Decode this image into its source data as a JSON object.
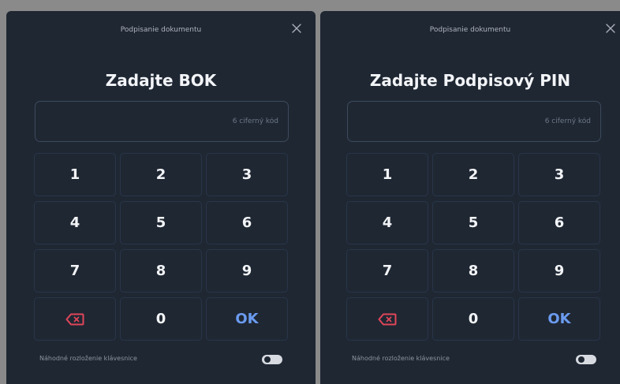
{
  "dialogs": [
    {
      "header_title": "Podpisanie dokumentu",
      "heading": "Zadajte BOK",
      "input_placeholder": "6 ciferný kód",
      "input_value": "",
      "keys": [
        "1",
        "2",
        "3",
        "4",
        "5",
        "6",
        "7",
        "8",
        "9",
        "backspace",
        "0",
        "OK"
      ],
      "random_layout_label": "Náhodné rozloženie klávesnice",
      "random_layout_enabled": false
    },
    {
      "header_title": "Podpisanie dokumentu",
      "heading": "Zadajte Podpisový PIN",
      "input_placeholder": "6 ciferný kód",
      "input_value": "",
      "keys": [
        "1",
        "2",
        "3",
        "4",
        "5",
        "6",
        "7",
        "8",
        "9",
        "backspace",
        "0",
        "OK"
      ],
      "random_layout_label": "Náhodné rozloženie klávesnice",
      "random_layout_enabled": false
    }
  ],
  "icons": {
    "close": "close-icon",
    "backspace": "backspace-icon"
  },
  "colors": {
    "dialog_bg": "#1f2733",
    "key_border": "#27364a",
    "ok_text": "#6b9bf0",
    "backspace_icon": "#e0465a",
    "page_bg": "#8a8a8a"
  }
}
